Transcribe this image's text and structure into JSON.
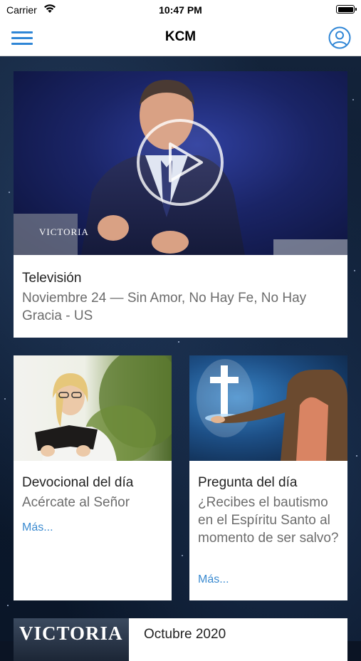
{
  "status_bar": {
    "carrier": "Carrier",
    "time": "10:47 PM"
  },
  "nav": {
    "title": "KCM",
    "menu_icon": "hamburger-menu-icon",
    "profile_icon": "user-profile-icon",
    "accent_color": "#2f86d6"
  },
  "cards": {
    "television": {
      "category": "Televisión",
      "title": "Noviembre 24 — Sin Amor, No Hay Fe, No Hay Gracia - US",
      "overlay_text": "VICTORIA",
      "play_icon": "play-icon"
    },
    "devotional": {
      "category": "Devocional del día",
      "title": "Acércate al Señor",
      "more": "Más..."
    },
    "question": {
      "category": "Pregunta del día",
      "title": "¿Recibes el bautismo en el Espíritu Santo al momento de ser salvo?",
      "more": "Más..."
    },
    "magazine": {
      "brand": "VICTORIA",
      "title": "Octubre 2020"
    }
  },
  "colors": {
    "link": "#3a8ad0",
    "background": "#0c1a2e"
  }
}
